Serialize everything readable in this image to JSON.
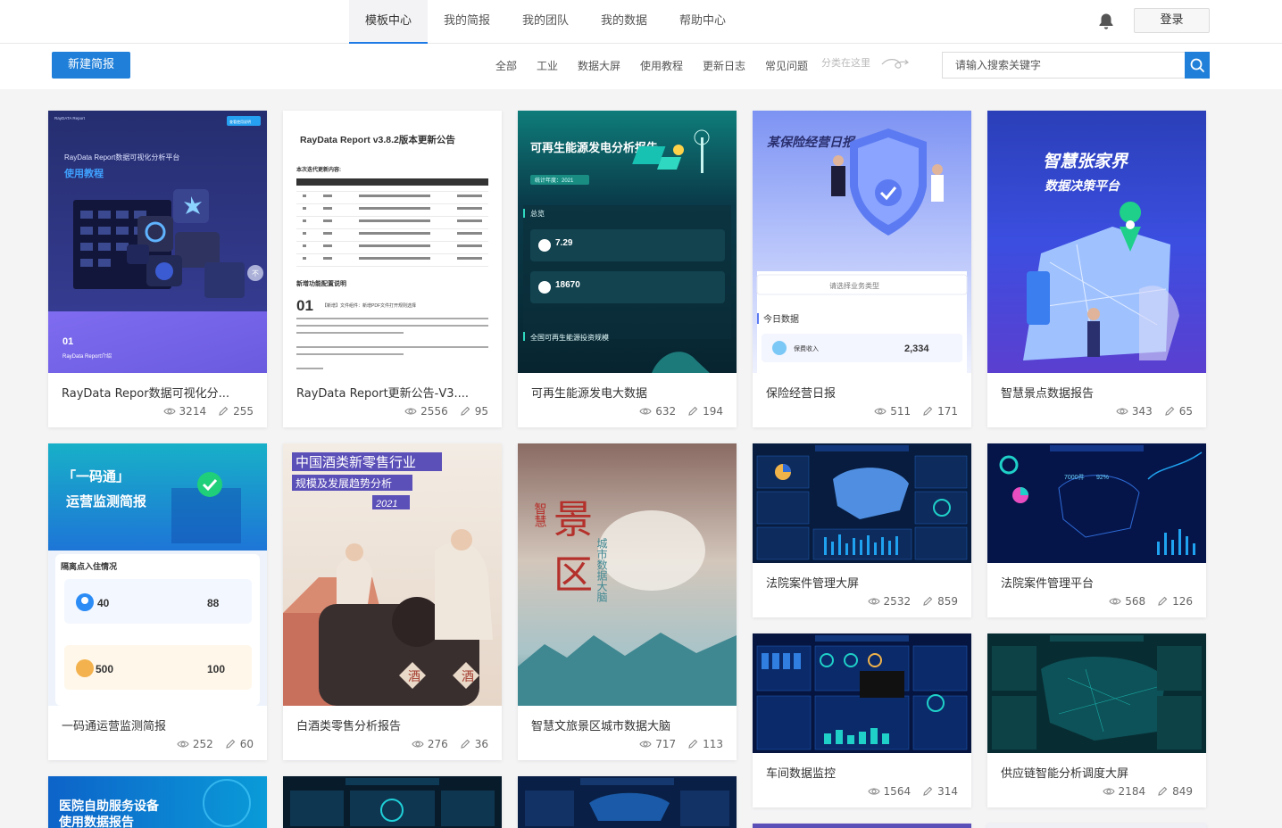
{
  "nav": {
    "tabs": [
      "模板中心",
      "我的简报",
      "我的团队",
      "我的数据",
      "帮助中心"
    ],
    "active": 0,
    "login": "登录"
  },
  "toolbar": {
    "new_report": "新建简报",
    "categories": [
      "全部",
      "工业",
      "数据大屏",
      "使用教程",
      "更新日志",
      "常见问题"
    ],
    "category_hint": "分类在这里",
    "search_placeholder": "请输入搜索关键字"
  },
  "colors": {
    "accent": "#1f7fd9"
  },
  "cards": [
    {
      "title": "RayData Repor数据可视化分...",
      "views": "3214",
      "likes": "255",
      "thumb": {
        "brand": "RayDATA Report",
        "tag": "查看使用说明",
        "line1": "RayData Report数据可视化分析平台",
        "line2": "使用教程",
        "num": "01",
        "sub": "RayData Report介绍"
      }
    },
    {
      "title": "RayData Report更新公告-V3....",
      "views": "2556",
      "likes": "95",
      "thumb": {
        "heading": "RayData Report v3.8.2版本更新公告",
        "sub": "本次迭代更新内容:",
        "section": "新增功能配置说明",
        "num": "01",
        "note": "【新增】文件组件：新增PDF文件打开规则选择"
      }
    },
    {
      "title": "可再生能源发电大数据",
      "views": "632",
      "likes": "194",
      "thumb": {
        "heading": "可再生能源发电分析报告",
        "tag": "统计年度：2021",
        "section": "总览",
        "v1": "7.29",
        "v2": "18670",
        "section2": "全国可再生能源投资规模"
      }
    },
    {
      "title": "保险经营日报",
      "views": "511",
      "likes": "171",
      "thumb": {
        "heading": "某保险经营日报",
        "select": "请选择业务类型",
        "section": "今日数据",
        "label": "保费收入",
        "value": "2,334"
      }
    },
    {
      "title": "智慧景点数据报告",
      "views": "343",
      "likes": "65",
      "thumb": {
        "heading": "智慧张家界",
        "sub": "数据决策平台"
      }
    },
    {
      "title": "一码通运营监测简报",
      "views": "252",
      "likes": "60",
      "thumb": {
        "heading": "「一码通」",
        "sub": "运营监测简报",
        "section": "隔离点入住情况",
        "a": "40",
        "b": "88",
        "c": "500",
        "d": "100"
      }
    },
    {
      "title": "白酒类零售分析报告",
      "views": "276",
      "likes": "36",
      "thumb": {
        "heading": "中国酒类新零售行业",
        "sub": "规模及发展趋势分析",
        "year": "2021"
      }
    },
    {
      "title": "智慧文旅景区城市数据大脑",
      "views": "717",
      "likes": "113",
      "thumb": {
        "c1": "景",
        "c2": "区",
        "side": "智慧",
        "v": "城市数据大脑"
      }
    },
    {
      "title": "法院案件管理大屏",
      "views": "2532",
      "likes": "859",
      "thumb": {}
    },
    {
      "title": "法院案件管理平台",
      "views": "568",
      "likes": "126",
      "thumb": {}
    },
    {
      "title": "车间数据监控",
      "views": "1564",
      "likes": "314",
      "thumb": {}
    },
    {
      "title": "供应链智能分析调度大屏",
      "views": "2184",
      "likes": "849",
      "thumb": {}
    },
    {
      "title": "",
      "views": "",
      "likes": "",
      "thumb": {
        "heading": "医院自助服务设备",
        "sub": "使用数据报告"
      }
    },
    {
      "title": "",
      "views": "",
      "likes": "",
      "thumb": {}
    },
    {
      "title": "",
      "views": "",
      "likes": "",
      "thumb": {}
    }
  ]
}
